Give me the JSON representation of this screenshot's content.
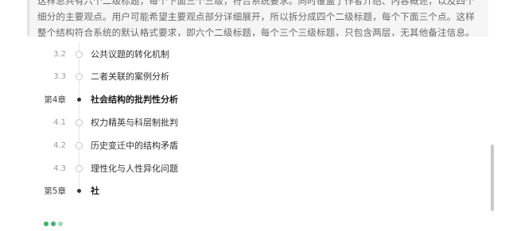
{
  "note": {
    "text": "这样总共有六个二级标题，每个下面三个三级，符合系统要求。同时覆盖了作者介绍、内容概述，以及四个细分的主要观点。用户可能希望主要观点部分详细展开，所以拆分成四个二级标题，每个下面三个点。这样整个结构符合系统的默认格式要求，即六个二级标题，每个三个三级标题，只包含两层，无其他备注信息。"
  },
  "toc": [
    {
      "num": "3.2",
      "title": "公共议题的转化机制",
      "type": "section"
    },
    {
      "num": "3.3",
      "title": "二者关联的案例分析",
      "type": "section"
    },
    {
      "num": "第4章",
      "title": "社会结构的批判性分析",
      "type": "chapter"
    },
    {
      "num": "4.1",
      "title": "权力精英与科层制批判",
      "type": "section"
    },
    {
      "num": "4.2",
      "title": "历史变迁中的结构矛盾",
      "type": "section"
    },
    {
      "num": "4.3",
      "title": "理性化与人性异化问题",
      "type": "section"
    },
    {
      "num": "第5章",
      "title": "社",
      "type": "chapter"
    }
  ],
  "status": {
    "indicator": "typing-dots-icon",
    "color": "#3bb56b"
  }
}
